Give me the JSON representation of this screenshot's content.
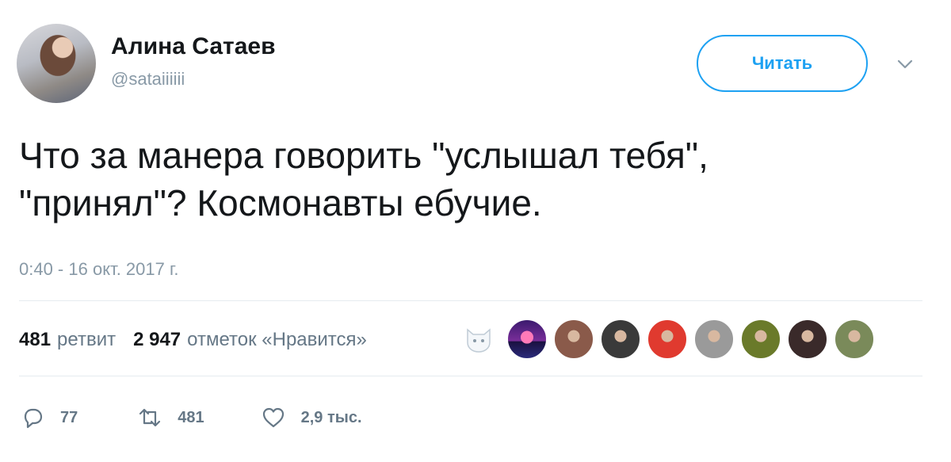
{
  "user": {
    "name": "Алина Сатаев",
    "handle": "@sataiiiiii"
  },
  "follow_button": {
    "label": "Читать"
  },
  "tweet": {
    "line1": "Что за манера говорить \"услышал тебя\",",
    "line2": "\"принял\"? Космонавты ебучие.",
    "timestamp": "0:40 - 16 окт. 2017 г."
  },
  "stats": {
    "retweets_count": "481",
    "retweets_label": "ретвит",
    "likes_count": "2 947",
    "likes_label": "отметок «Нравится»"
  },
  "likers": [
    {
      "icon": "cat-avatar",
      "color": "#e8eef3"
    },
    {
      "icon": "synthwave-avatar",
      "color": "#5b2a86"
    },
    {
      "icon": "user-avatar",
      "color": "#8a5a4a"
    },
    {
      "icon": "user-avatar",
      "color": "#3a3a3a"
    },
    {
      "icon": "user-avatar",
      "color": "#e03a2f"
    },
    {
      "icon": "user-avatar",
      "color": "#9a9a9a"
    },
    {
      "icon": "user-avatar",
      "color": "#6a7a2a"
    },
    {
      "icon": "user-avatar",
      "color": "#3a2a2a"
    },
    {
      "icon": "user-avatar",
      "color": "#7a8a5a"
    }
  ],
  "actions": {
    "replies": "77",
    "retweets": "481",
    "likes": "2,9 тыс."
  },
  "colors": {
    "accent": "#1da1f2",
    "secondary_text": "#8899a6",
    "divider": "#e6ecf0"
  }
}
